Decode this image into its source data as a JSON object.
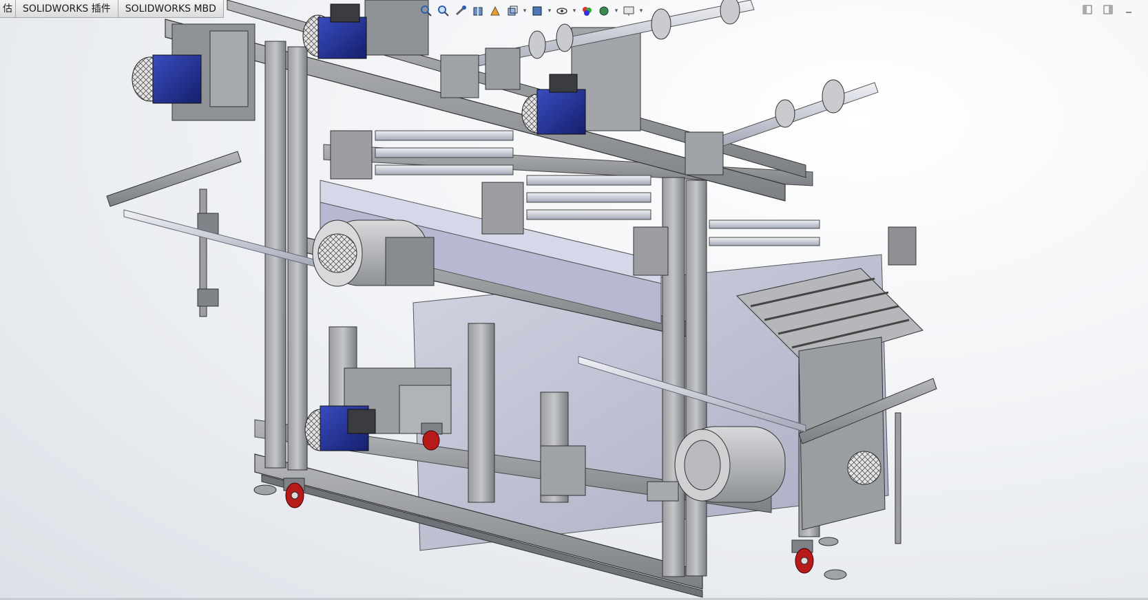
{
  "tabs": [
    {
      "label": "估"
    },
    {
      "label": "SOLIDWORKS 插件"
    },
    {
      "label": "SOLIDWORKS MBD"
    }
  ],
  "heads_up_toolbar": {
    "icons": [
      "zoom-to-fit-icon",
      "zoom-to-area-icon",
      "previous-view-icon",
      "section-view-icon",
      "dynamic-annotation-icon",
      "view-orientation-icon",
      "display-style-icon",
      "hide-show-items-icon",
      "edit-appearance-icon",
      "apply-scene-icon",
      "view-settings-icon"
    ]
  },
  "window_controls": {
    "icons": [
      "tile-left-icon",
      "tile-right-icon",
      "minimize-icon"
    ]
  },
  "colors": {
    "frame": "#8e9093",
    "frame_dark": "#5f6165",
    "motor_blue": "#1f2f9a",
    "caster_red": "#b81a1a",
    "panel": "#b9bcd0"
  }
}
